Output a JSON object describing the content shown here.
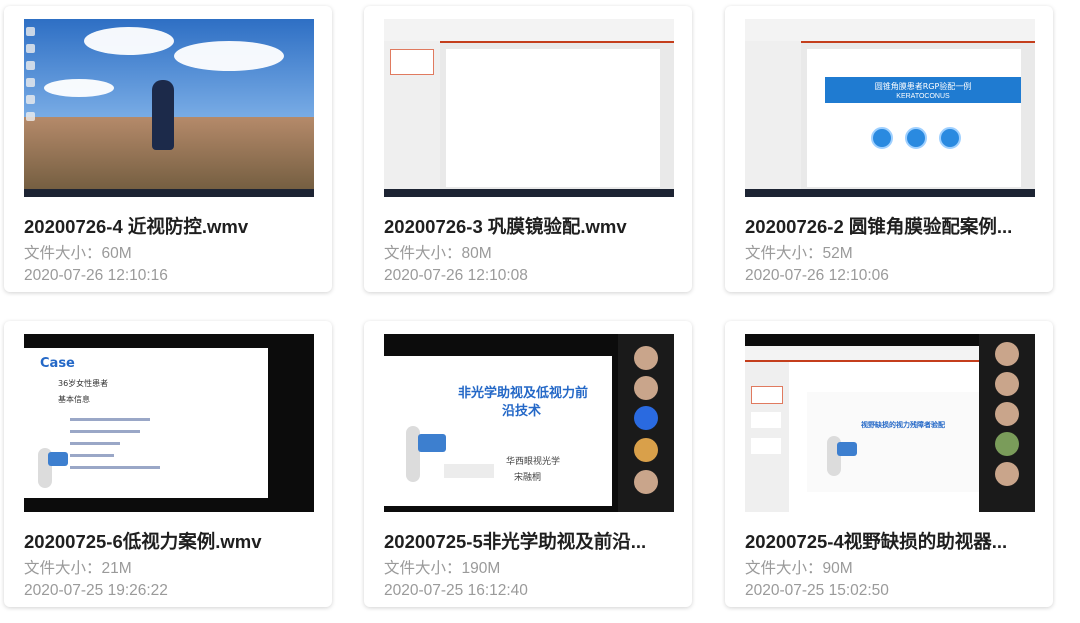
{
  "size_label": "文件大小：",
  "items": [
    {
      "title": "20200726-4 近视防控.wmv",
      "size": "60M",
      "date": "2020-07-26 12:10:16"
    },
    {
      "title": "20200726-3 巩膜镜验配.wmv",
      "size": "80M",
      "date": "2020-07-26 12:10:08"
    },
    {
      "title": "20200726-2 圆锥角膜验配案例...",
      "size": "52M",
      "date": "2020-07-26 12:10:06"
    },
    {
      "title": "20200725-6低视力案例.wmv",
      "size": "21M",
      "date": "2020-07-25 19:26:22"
    },
    {
      "title": "20200725-5非光学助视及前沿...",
      "size": "190M",
      "date": "2020-07-25 16:12:40"
    },
    {
      "title": "20200725-4视野缺损的助视器...",
      "size": "90M",
      "date": "2020-07-25 15:02:50"
    }
  ],
  "thumbs": {
    "t3_title": "圆锥角膜患者RGP验配一例",
    "t3_sub": "KERATOCONUS",
    "t4_case": "Case",
    "t4_line1": "36岁女性患者",
    "t4_line2": "基本信息",
    "t5_title1": "非光学助视及低视力前",
    "t5_title2": "沿技术",
    "t5_org": "华西眼视光学",
    "t5_name": "宋融桐",
    "t6_title": "视野缺损的视力残障者验配"
  }
}
